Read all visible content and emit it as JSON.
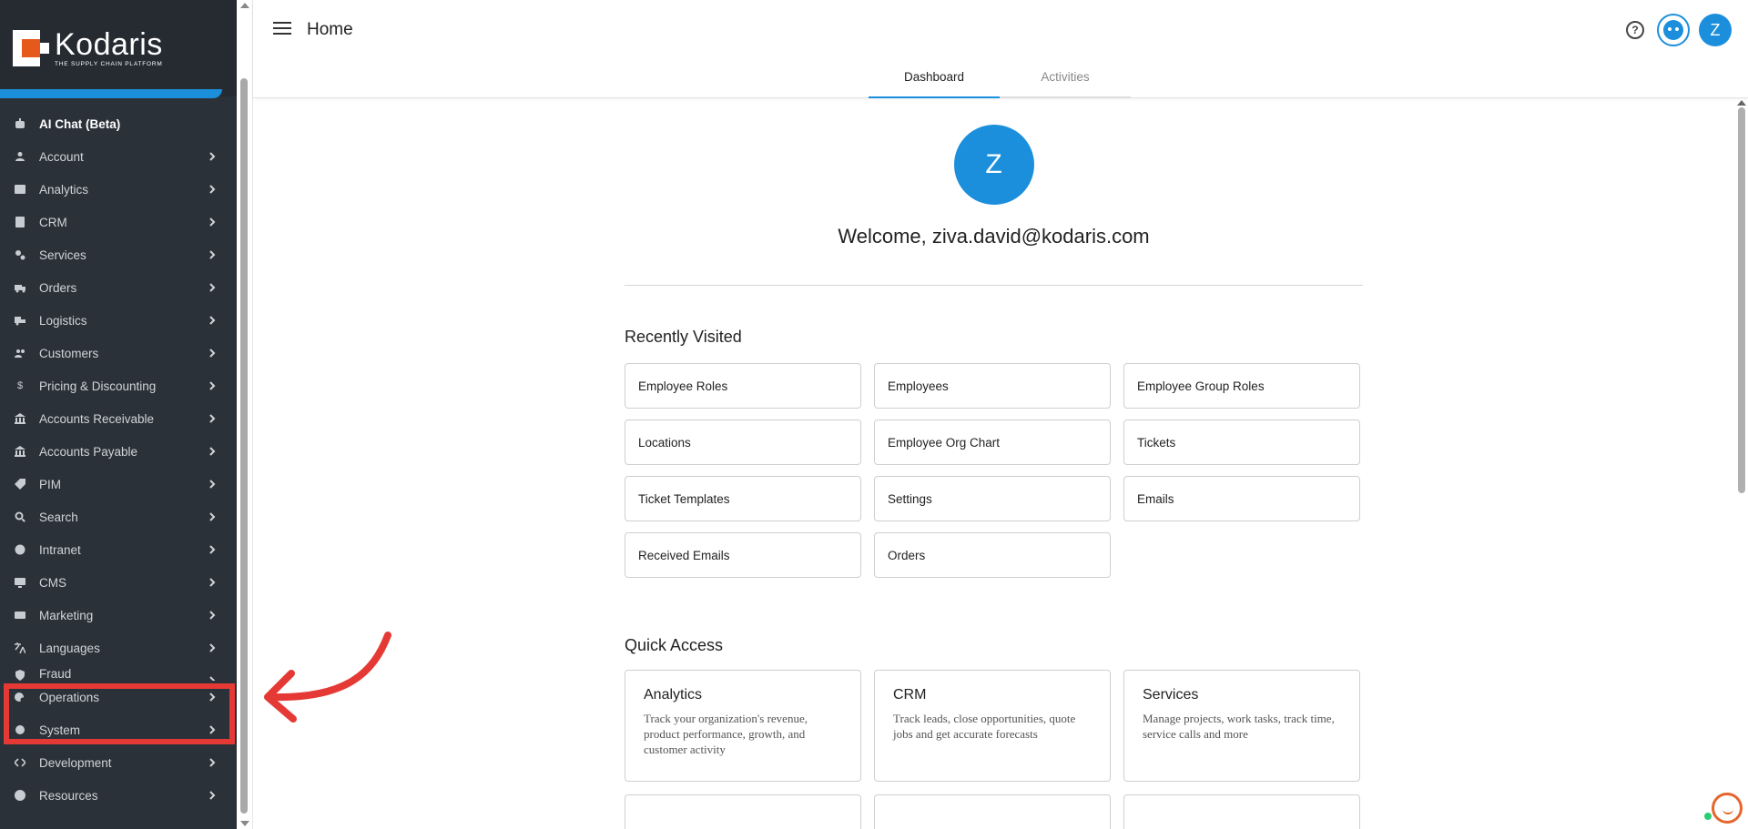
{
  "brand": {
    "name": "Kodaris",
    "tagline": "THE SUPPLY CHAIN PLATFORM"
  },
  "sidebar": {
    "items": [
      {
        "label": "AI Chat (Beta)",
        "icon": "robot-icon",
        "chevron": false
      },
      {
        "label": "Account",
        "icon": "user-icon",
        "chevron": true
      },
      {
        "label": "Analytics",
        "icon": "chart-icon",
        "chevron": true
      },
      {
        "label": "CRM",
        "icon": "contact-card-icon",
        "chevron": true
      },
      {
        "label": "Services",
        "icon": "gears-icon",
        "chevron": true
      },
      {
        "label": "Orders",
        "icon": "truck-icon",
        "chevron": true
      },
      {
        "label": "Logistics",
        "icon": "shipping-icon",
        "chevron": true
      },
      {
        "label": "Customers",
        "icon": "people-icon",
        "chevron": true
      },
      {
        "label": "Pricing & Discounting",
        "icon": "dollar-icon",
        "chevron": true
      },
      {
        "label": "Accounts Receivable",
        "icon": "bank-icon",
        "chevron": true
      },
      {
        "label": "Accounts Payable",
        "icon": "bank-icon",
        "chevron": true
      },
      {
        "label": "PIM",
        "icon": "tag-icon",
        "chevron": true
      },
      {
        "label": "Search",
        "icon": "search-icon",
        "chevron": true
      },
      {
        "label": "Intranet",
        "icon": "globe-icon",
        "chevron": true
      },
      {
        "label": "CMS",
        "icon": "monitor-icon",
        "chevron": true
      },
      {
        "label": "Marketing",
        "icon": "id-card-icon",
        "chevron": true
      },
      {
        "label": "Languages",
        "icon": "translate-icon",
        "chevron": true
      },
      {
        "label": "Fraud",
        "icon": "shield-icon",
        "chevron": true
      },
      {
        "label": "Operations",
        "icon": "operations-icon",
        "chevron": true
      },
      {
        "label": "System",
        "icon": "gear-icon",
        "chevron": true
      },
      {
        "label": "Development",
        "icon": "code-icon",
        "chevron": true
      },
      {
        "label": "Resources",
        "icon": "question-icon",
        "chevron": true
      }
    ]
  },
  "header": {
    "title": "Home",
    "avatar_initial": "Z"
  },
  "tabs": [
    {
      "label": "Dashboard",
      "active": true
    },
    {
      "label": "Activities",
      "active": false
    }
  ],
  "profile": {
    "initial": "Z",
    "welcome": "Welcome, ziva.david@kodaris.com"
  },
  "recently_visited": {
    "title": "Recently Visited",
    "items": [
      "Employee Roles",
      "Employees",
      "Employee Group Roles",
      "Locations",
      "Employee Org Chart",
      "Tickets",
      "Ticket Templates",
      "Settings",
      "Emails",
      "Received Emails",
      "Orders"
    ]
  },
  "quick_access": {
    "title": "Quick Access",
    "items": [
      {
        "title": "Analytics",
        "desc": "Track your organization's revenue, product performance, growth, and customer activity"
      },
      {
        "title": "CRM",
        "desc": "Track leads, close opportunities, quote jobs and get accurate forecasts"
      },
      {
        "title": "Services",
        "desc": "Manage projects, work tasks, track time, service calls and more"
      }
    ]
  },
  "colors": {
    "sidebar_bg": "#2b3138",
    "accent": "#1b8fdc",
    "annotation": "#e53935",
    "brand_orange": "#e55a1c"
  }
}
